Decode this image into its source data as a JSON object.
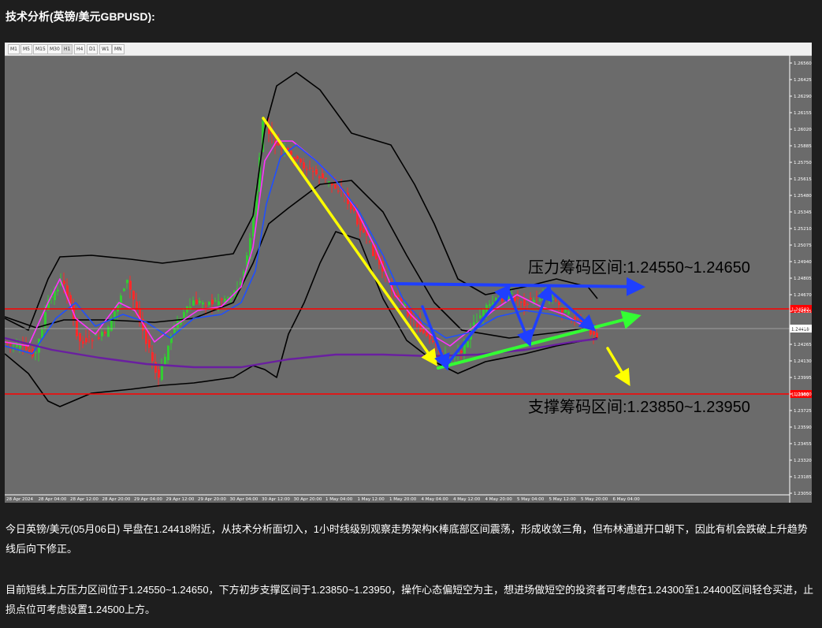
{
  "page": {
    "title": "技术分析(英镑/美元GBPUSD):",
    "paragraph_1": "今日英镑/美元(05月06日) 早盘在1.24418附近，从技术分析面切入，1小时线级别观察走势架构K棒底部区间震荡，形成收敛三角，但布林通道开口朝下，因此有机会跌破上升趋势线后向下修正。",
    "paragraph_2": "目前短线上方压力区间位于1.24550~1.24650，下方初步支撑区间于1.23850~1.23950，操作心态偏短空为主，想进场做短空的投资者可考虑在1.24300至1.24400区间轻仓买进，止损点位可考虑设置1.24500上方。"
  },
  "toolbar": {
    "timeframes": [
      "M1",
      "M5",
      "M15",
      "M30",
      "H1",
      "H4",
      "D1",
      "W1",
      "MN"
    ],
    "active": "H1"
  },
  "chart": {
    "resistance_label": "压力筹码区间:1.24550~1.24650",
    "support_label": "支撑筹码区间:1.23850~1.23950",
    "price_ticks": [
      "1.26560",
      "1.26425",
      "1.26290",
      "1.26155",
      "1.26020",
      "1.25885",
      "1.25750",
      "1.25615",
      "1.25480",
      "1.25345",
      "1.25210",
      "1.25075",
      "1.24940",
      "1.24805",
      "1.24670",
      "1.24535",
      "1.24400",
      "1.24265",
      "1.24130",
      "1.23995",
      "1.23860",
      "1.23725",
      "1.23590",
      "1.23455",
      "1.23320",
      "1.23185",
      "1.23050"
    ],
    "time_ticks": [
      "28 Apr 2024",
      "28 Apr 04:00",
      "28 Apr 12:00",
      "28 Apr 20:00",
      "29 Apr 04:00",
      "29 Apr 12:00",
      "29 Apr 20:00",
      "30 Apr 04:00",
      "30 Apr 12:00",
      "30 Apr 20:00",
      "1 May 04:00",
      "1 May 12:00",
      "1 May 20:00",
      "4 May 04:00",
      "4 May 12:00",
      "4 May 20:00",
      "5 May 04:00",
      "5 May 12:00",
      "5 May 20:00",
      "6 May 04:00"
    ],
    "current_price": "1.24418",
    "red_line_upper": "1.24582",
    "red_line_lower": "1.23902",
    "colors": {
      "background": "#6b6b6b",
      "bull_candle": "#33cc33",
      "bear_candle": "#ff2a2a",
      "bollinger": "#000000",
      "ma_fast": "#ff33ff",
      "ma_mid": "#1f4fff",
      "ma_slow": "#6a1fa0",
      "trend_yellow": "#ffff00",
      "trend_green": "#33ff33",
      "trend_blue": "#1f3fff",
      "level_red": "#ff0000"
    }
  }
}
